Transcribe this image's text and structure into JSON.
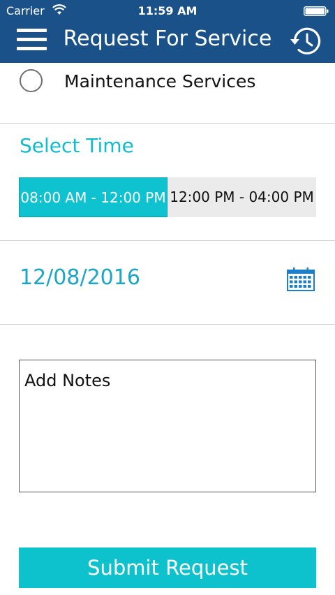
{
  "status_bar": {
    "carrier": "Carrier",
    "time": "11:59 AM"
  },
  "header": {
    "title": "Request For Service",
    "menu_icon": "hamburger-menu-icon",
    "history_icon": "history-icon"
  },
  "service_option": {
    "label": "Maintenance Services",
    "selected": false
  },
  "time_section": {
    "title": "Select Time",
    "options": [
      {
        "label": "08:00 AM - 12:00 PM",
        "selected": true
      },
      {
        "label": "12:00 PM - 04:00 PM",
        "selected": false
      }
    ]
  },
  "date": {
    "value": "12/08/2016",
    "icon": "calendar-icon"
  },
  "notes": {
    "placeholder": "Add Notes",
    "value": ""
  },
  "submit": {
    "label": "Submit Request"
  },
  "colors": {
    "header_bg": "#1b5189",
    "accent": "#0fc2d0",
    "date_text": "#19a6c7"
  }
}
